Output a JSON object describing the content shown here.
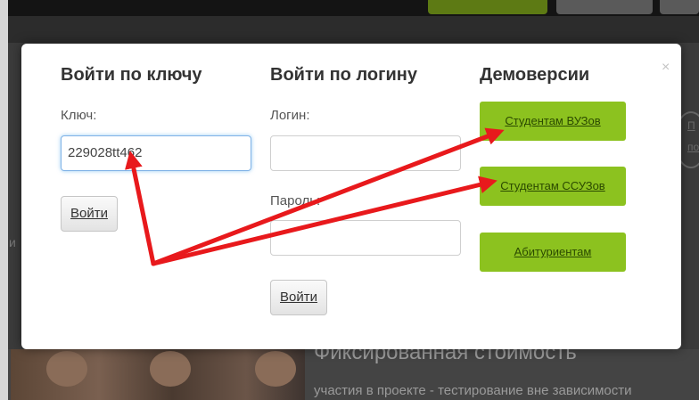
{
  "background": {
    "heading": "Фиксированная стоимость",
    "subheading": "участия в проекте - тестирование вне зависимости",
    "side_link_1": "П",
    "side_link_2": "по",
    "left_letter": "и"
  },
  "modal": {
    "close_label": "×",
    "key_column": {
      "title": "Войти по ключу",
      "key_label": "Ключ:",
      "key_value": "229028tt462",
      "submit_label": "Войти"
    },
    "login_column": {
      "title": "Войти по логину",
      "login_label": "Логин:",
      "login_value": "",
      "password_label": "Пароль:",
      "password_value": "",
      "submit_label": "Войти"
    },
    "demo_column": {
      "title": "Демоверсии",
      "buttons": [
        {
          "label": "Студентам ВУЗов"
        },
        {
          "label": "Студентам ССУЗов"
        },
        {
          "label": "Абитуриентам"
        }
      ]
    }
  },
  "colors": {
    "demo_button": "#8cc21f",
    "arrow": "#e8191c",
    "input_focus": "#7fb2e6"
  }
}
